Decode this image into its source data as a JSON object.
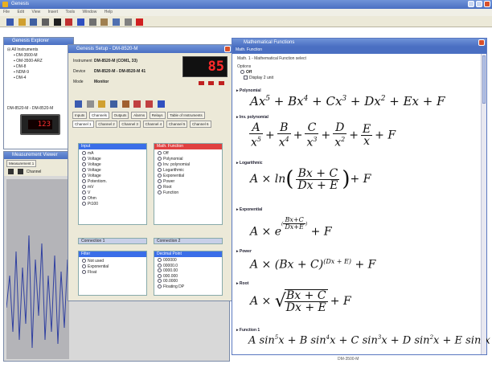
{
  "app": {
    "title": "Genesis",
    "menu": [
      "File",
      "Edit",
      "View",
      "Insert",
      "Tools",
      "Window",
      "Help"
    ]
  },
  "explorer": {
    "title": "Genesis Explorer",
    "tree": [
      "All Instruments",
      "DM-3500-M",
      "OM-3500-ARZ",
      "DM-8",
      "NDM-9",
      "DM-4"
    ],
    "device_caption": "DM-8520-M - DM-8520-M",
    "display_value": "123"
  },
  "measurement": {
    "title": "Measurement Viewer",
    "tab": "Measurement 1",
    "channel_label": "Channel"
  },
  "setup": {
    "title": "Genesis Setup - DM-8520-M",
    "fields": [
      {
        "label": "Instrument",
        "value": "DM-8520-M (COM1, 33)"
      },
      {
        "label": "Device",
        "value": "DM-8520-M  - DM-8520-M 41"
      },
      {
        "label": "Mode",
        "value": "Monitor"
      }
    ],
    "display_value": "85",
    "tabs": [
      "Inputs",
      "Channels",
      "Outputs",
      "Alarms",
      "Relays",
      "Table of Instruments"
    ],
    "subtabs": [
      "Channel 1",
      "Channel 2",
      "Channel 3",
      "Channel 4",
      "Channel 5",
      "Channel 6"
    ],
    "group_input": {
      "title": "Input",
      "items": [
        "mA",
        "Voltage",
        "Voltage",
        "Voltage",
        "Voltage",
        "Potentiom.",
        "mV",
        "V",
        "Ohm",
        "Pt100"
      ]
    },
    "group_math": {
      "title": "Math. Function",
      "items": [
        "Off",
        "Polynomial",
        "Inv. polynomial",
        "Logarithmic",
        "Exponential",
        "Power",
        "Root",
        "Function"
      ]
    },
    "group_filter": {
      "title": "Filter",
      "items": [
        "Not used",
        "Exponential",
        "Float"
      ]
    },
    "group_decimal": {
      "title": "Decimal Point",
      "items": [
        "000000",
        "00000.0",
        "0000.00",
        "000.000",
        "00.0000",
        "Floating DP"
      ]
    },
    "sections": [
      "Connection 1",
      "Connection 2"
    ]
  },
  "math": {
    "title": "Mathematical Functions",
    "heading": "Math. Function",
    "subheading": "Math. 1 - Mathematical Function select",
    "options_label": "Options",
    "options": [
      "Off",
      "Display 2 unit"
    ],
    "functions": [
      {
        "name": "Polynomial"
      },
      {
        "name": "Inv. polynomial"
      },
      {
        "name": "Logarithmic"
      },
      {
        "name": "Exponential"
      },
      {
        "name": "Power"
      },
      {
        "name": "Root"
      },
      {
        "name": "Function 1"
      }
    ],
    "tail_text": "+F",
    "status_text": "DM-3500-M"
  },
  "colors": {
    "title_blue": "#4a6fc2",
    "panel": "#ece9d8",
    "led_red": "#ff2a2a",
    "plot_line": "#3040a0"
  }
}
